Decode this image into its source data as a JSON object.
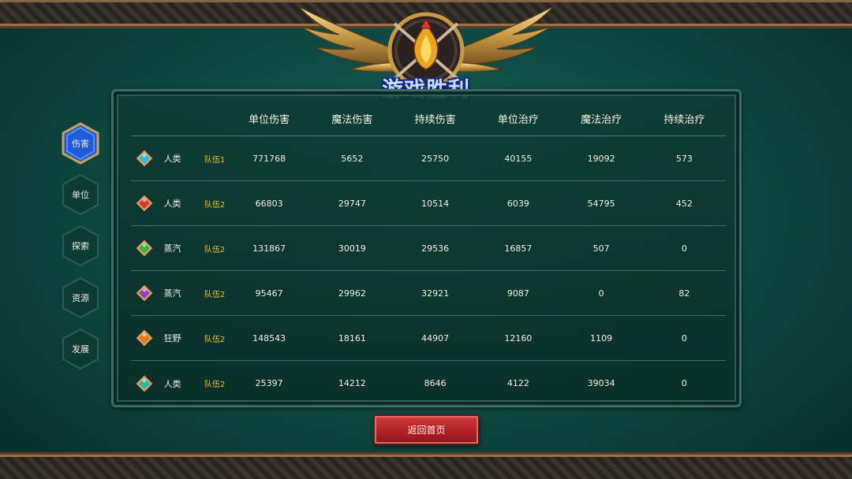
{
  "banner": {
    "title": "游戏胜利"
  },
  "side_tabs": [
    {
      "label": "伤害",
      "active": true
    },
    {
      "label": "单位",
      "active": false
    },
    {
      "label": "探索",
      "active": false
    },
    {
      "label": "资源",
      "active": false
    },
    {
      "label": "发展",
      "active": false
    }
  ],
  "table": {
    "headers": [
      "单位伤害",
      "魔法伤害",
      "持续伤害",
      "单位治疗",
      "魔法治疗",
      "持续治疗"
    ],
    "rows": [
      {
        "gem": "diamond-gem-blue",
        "gem_color": "#2fb7e0",
        "race": "人类",
        "team": "队伍1",
        "values": [
          "771768",
          "5652",
          "25750",
          "40155",
          "19092",
          "573"
        ]
      },
      {
        "gem": "diamond-gem-red",
        "gem_color": "#d8362c",
        "race": "人类",
        "team": "队伍2",
        "values": [
          "66803",
          "29747",
          "10514",
          "6039",
          "54795",
          "452"
        ]
      },
      {
        "gem": "diamond-gem-green",
        "gem_color": "#3fb040",
        "race": "蒸汽",
        "team": "队伍2",
        "values": [
          "131867",
          "30019",
          "29536",
          "16857",
          "507",
          "0"
        ]
      },
      {
        "gem": "diamond-gem-purple",
        "gem_color": "#9a3ad0",
        "race": "蒸汽",
        "team": "队伍2",
        "values": [
          "95467",
          "29962",
          "32921",
          "9087",
          "0",
          "82"
        ]
      },
      {
        "gem": "diamond-gem-orange",
        "gem_color": "#e07a1a",
        "race": "狂野",
        "team": "队伍2",
        "values": [
          "148543",
          "18161",
          "44907",
          "12160",
          "1109",
          "0"
        ]
      },
      {
        "gem": "diamond-gem-teal",
        "gem_color": "#2fb3a8",
        "race": "人类",
        "team": "队伍2",
        "values": [
          "25397",
          "14212",
          "8646",
          "4122",
          "39034",
          "0"
        ]
      }
    ]
  },
  "footer": {
    "home_button": "返回首页"
  },
  "colors": {
    "active_tab": "#1f5bd8",
    "team_text": "#e8c23a",
    "home_button": "#c0282c"
  }
}
